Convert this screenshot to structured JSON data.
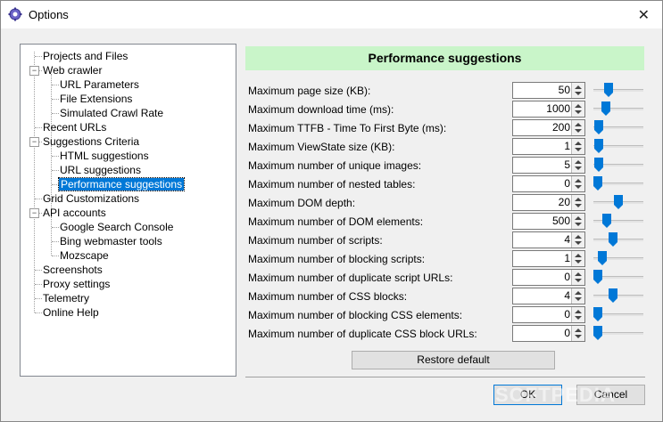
{
  "window": {
    "title": "Options",
    "close_label": "✕"
  },
  "tree": {
    "items": [
      {
        "label": "Projects and Files"
      },
      {
        "label": "Web crawler"
      },
      {
        "label": "URL Parameters"
      },
      {
        "label": "File Extensions"
      },
      {
        "label": "Simulated Crawl Rate"
      },
      {
        "label": "Recent URLs"
      },
      {
        "label": "Suggestions Criteria"
      },
      {
        "label": "HTML suggestions"
      },
      {
        "label": "URL suggestions"
      },
      {
        "label": "Performance suggestions"
      },
      {
        "label": "Grid Customizations"
      },
      {
        "label": "API accounts"
      },
      {
        "label": "Google Search Console"
      },
      {
        "label": "Bing webmaster tools"
      },
      {
        "label": "Mozscape"
      },
      {
        "label": "Screenshots"
      },
      {
        "label": "Proxy settings"
      },
      {
        "label": "Telemetry"
      },
      {
        "label": "Online Help"
      }
    ]
  },
  "panel": {
    "title": "Performance suggestions",
    "rows": [
      {
        "label": "Maximum page size (KB):",
        "value": "50",
        "level": 0.25
      },
      {
        "label": "Maximum download time (ms):",
        "value": "1000",
        "level": 0.2
      },
      {
        "label": "Maximum TTFB - Time To First Byte (ms):",
        "value": "200",
        "level": 0.02
      },
      {
        "label": "Maximum ViewState size (KB):",
        "value": "1",
        "level": 0.02
      },
      {
        "label": "Maximum number of unique images:",
        "value": "5",
        "level": 0.02
      },
      {
        "label": "Maximum number of nested tables:",
        "value": "0",
        "level": 0.0
      },
      {
        "label": "Maximum DOM depth:",
        "value": "20",
        "level": 0.5
      },
      {
        "label": "Maximum number of DOM elements:",
        "value": "500",
        "level": 0.22
      },
      {
        "label": "Maximum number of scripts:",
        "value": "4",
        "level": 0.38
      },
      {
        "label": "Maximum number of blocking scripts:",
        "value": "1",
        "level": 0.1
      },
      {
        "label": "Maximum number of duplicate script URLs:",
        "value": "0",
        "level": 0.0
      },
      {
        "label": "Maximum number of CSS blocks:",
        "value": "4",
        "level": 0.38
      },
      {
        "label": "Maximum number of blocking CSS elements:",
        "value": "0",
        "level": 0.0
      },
      {
        "label": "Maximum number of duplicate CSS block URLs:",
        "value": "0",
        "level": 0.0
      }
    ],
    "restore_label": "Restore default"
  },
  "footer": {
    "ok_label": "OK",
    "cancel_label": "Cancel"
  },
  "watermark": "SOFTPEDIA",
  "colors": {
    "header_bg": "#c9f5c9",
    "selection": "#0078d7",
    "thumb": "#0078d7"
  }
}
